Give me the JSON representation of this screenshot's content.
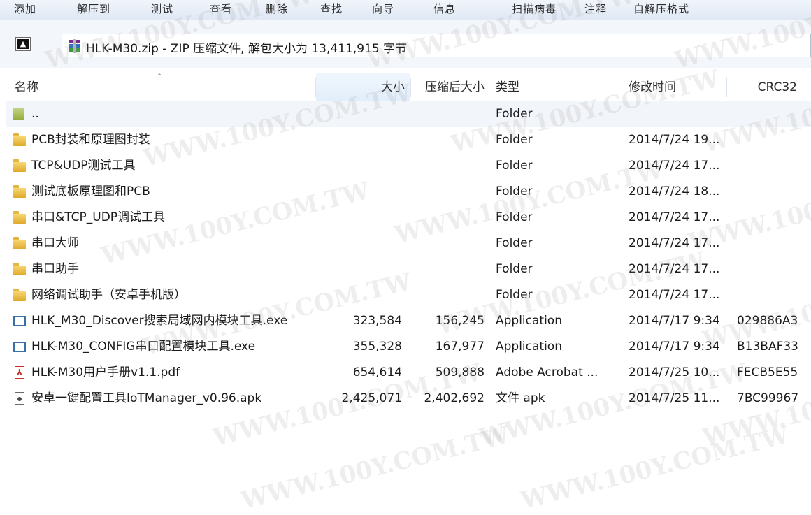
{
  "toolbar": {
    "items": [
      "添加",
      "解压到",
      "测试",
      "查看",
      "删除",
      "查找",
      "向导",
      "信息",
      "扫描病毒",
      "注释",
      "自解压格式"
    ]
  },
  "address": {
    "up_button": "up-folder-button",
    "text": "HLK-M30.zip - ZIP 压缩文件, 解包大小为 13,411,915 字节"
  },
  "columns": {
    "name": "名称",
    "size": "大小",
    "packed": "压缩后大小",
    "type": "类型",
    "modified": "修改时间",
    "crc": "CRC32"
  },
  "files": [
    {
      "icon": "updir-icon",
      "name": "..",
      "size": "",
      "packed": "",
      "type": "Folder",
      "modified": "",
      "crc": ""
    },
    {
      "icon": "folder-icon",
      "name": "PCB封装和原理图封装",
      "size": "",
      "packed": "",
      "type": "Folder",
      "modified": "2014/7/24 19...",
      "crc": ""
    },
    {
      "icon": "folder-icon",
      "name": "TCP&UDP测试工具",
      "size": "",
      "packed": "",
      "type": "Folder",
      "modified": "2014/7/24 17...",
      "crc": ""
    },
    {
      "icon": "folder-icon",
      "name": "测试底板原理图和PCB",
      "size": "",
      "packed": "",
      "type": "Folder",
      "modified": "2014/7/24 18...",
      "crc": ""
    },
    {
      "icon": "folder-icon",
      "name": "串口&TCP_UDP调试工具",
      "size": "",
      "packed": "",
      "type": "Folder",
      "modified": "2014/7/24 17...",
      "crc": ""
    },
    {
      "icon": "folder-icon",
      "name": "串口大师",
      "size": "",
      "packed": "",
      "type": "Folder",
      "modified": "2014/7/24 17...",
      "crc": ""
    },
    {
      "icon": "folder-icon",
      "name": "串口助手",
      "size": "",
      "packed": "",
      "type": "Folder",
      "modified": "2014/7/24 17...",
      "crc": ""
    },
    {
      "icon": "folder-icon",
      "name": "网络调试助手（安卓手机版）",
      "size": "",
      "packed": "",
      "type": "Folder",
      "modified": "2014/7/24 17...",
      "crc": ""
    },
    {
      "icon": "exe-icon",
      "name": "HLK_M30_Discover搜索局域网内模块工具.exe",
      "size": "323,584",
      "packed": "156,245",
      "type": "Application",
      "modified": "2014/7/17 9:34",
      "crc": "029886A3"
    },
    {
      "icon": "exe-icon",
      "name": "HLK-M30_CONFIG串口配置模块工具.exe",
      "size": "355,328",
      "packed": "167,977",
      "type": "Application",
      "modified": "2014/7/17 9:34",
      "crc": "B13BAF33"
    },
    {
      "icon": "pdf-icon",
      "name": "HLK-M30用户手册v1.1.pdf",
      "size": "654,614",
      "packed": "509,888",
      "type": "Adobe Acrobat ...",
      "modified": "2014/7/25 10...",
      "crc": "FECB5E55"
    },
    {
      "icon": "apk-icon",
      "name": "安卓一键配置工具IoTManager_v0.96.apk",
      "size": "2,425,071",
      "packed": "2,402,692",
      "type": "文件 apk",
      "modified": "2014/7/25 11...",
      "crc": "7BC99967"
    }
  ],
  "watermark": "WWW.100Y.COM.TW"
}
